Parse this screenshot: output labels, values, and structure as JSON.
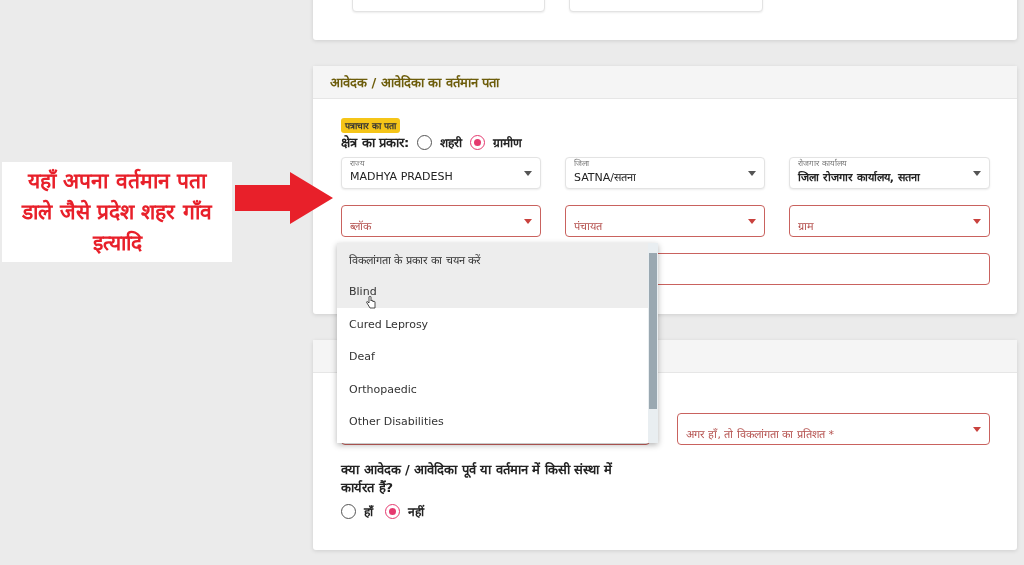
{
  "annotation": {
    "text": "यहाँ अपना वर्तमान पता डाले जैसे प्रदेश शहर गाँव इत्यादि"
  },
  "address_card": {
    "title": "आवेदक / आवेदिका का वर्तमान पता",
    "badge": "पत्राचार का पता",
    "area_type": {
      "label": "क्षेत्र का प्रकार:",
      "options": [
        {
          "label": "शहरी",
          "selected": false
        },
        {
          "label": "ग्रामीण",
          "selected": true
        }
      ]
    },
    "rows": [
      [
        {
          "label": "राज्य",
          "value": "MADHYA PRADESH",
          "invalid": false,
          "bold": false
        },
        {
          "label": "जिला",
          "value": "SATNA/सतना",
          "invalid": false,
          "bold": false
        },
        {
          "label": "रोजगार कार्यालय",
          "value": "जिला रोजगार कार्यालय, सतना",
          "invalid": false,
          "bold": true
        }
      ],
      [
        {
          "placeholder": "ब्लॉक",
          "invalid": true
        },
        {
          "placeholder": "पंचायत",
          "invalid": true
        },
        {
          "placeholder": "ग्राम",
          "invalid": true
        }
      ],
      [
        {
          "invalid": true
        }
      ]
    ]
  },
  "disability_card": {
    "fields": [
      {
        "placeholder": "अगर हाँ, तो विकलांगता का प्रतिशत *",
        "invalid": true
      }
    ],
    "question": "क्या आवेदक / आवेदिका पूर्व या वर्तमान में किसी संस्था में कार्यरत हैं?",
    "options": [
      {
        "label": "हाँ",
        "selected": false
      },
      {
        "label": "नहीं",
        "selected": true
      }
    ]
  },
  "dropdown": {
    "items": [
      {
        "label": "विकलांगता के प्रकार का चयन करें",
        "highlighted": true
      },
      {
        "label": "Blind",
        "highlighted": true
      },
      {
        "label": "Cured Leprosy",
        "highlighted": false
      },
      {
        "label": "Deaf",
        "highlighted": false
      },
      {
        "label": "Orthopaedic",
        "highlighted": false
      },
      {
        "label": "Other Disabilities",
        "highlighted": false
      }
    ]
  }
}
